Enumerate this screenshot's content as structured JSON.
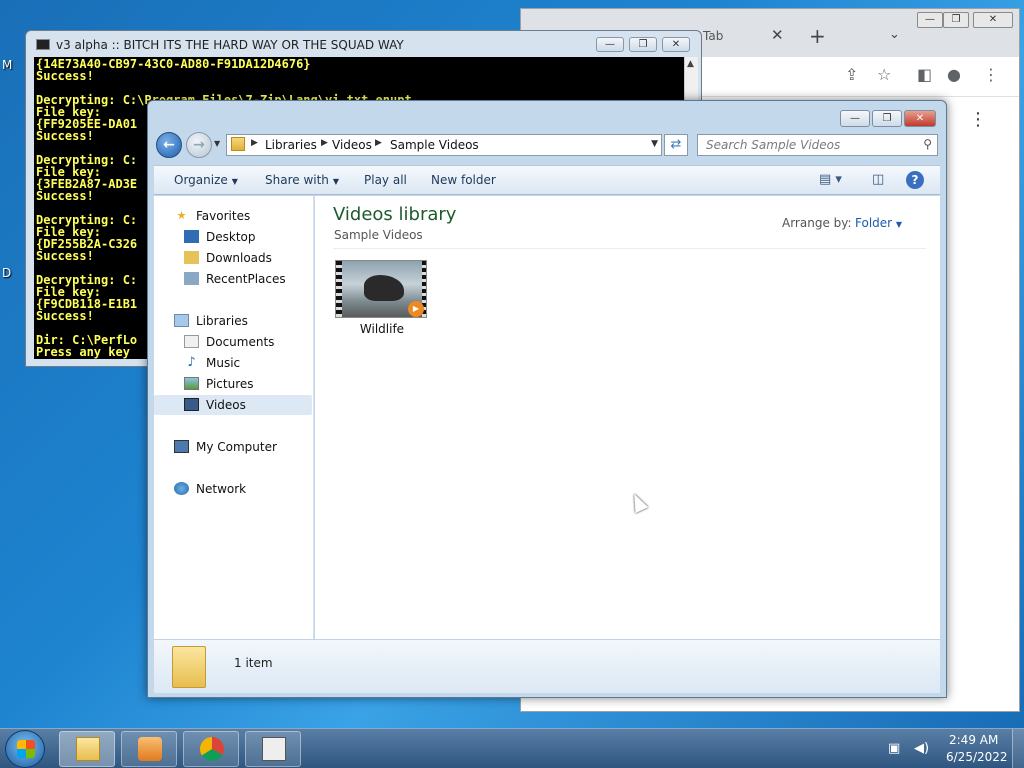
{
  "desktop": {
    "labels": [
      "M",
      "D"
    ]
  },
  "chrome": {
    "tab_label": "Tab",
    "tab_close": "✕",
    "new_tab": "+",
    "dropdown": "⌄",
    "min": "—",
    "max": "❐",
    "close": "✕",
    "toolbar_icons": [
      "share-icon",
      "star-icon",
      "sidebar-icon",
      "profile-icon",
      "menu-icon"
    ],
    "more": "⋮"
  },
  "console": {
    "title": "v3 alpha :: BITCH ITS THE HARD WAY OR THE SQUAD WAY",
    "lines": [
      "{14E73A40-CB97-43C0-AD80-F91DA12D4676}",
      "Success!",
      "",
      "Decrypting: C:\\Program Files\\7-Zip\\Lang\\yi.txt.enupt",
      "File key:",
      "{FF9205EE-DA01",
      "Success!",
      "",
      "Decrypting: C:",
      "File key:",
      "{3FEB2A87-AD3E",
      "Success!",
      "",
      "Decrypting: C:",
      "File key:",
      "{DF255B2A-C326",
      "Success!",
      "",
      "Decrypting: C:",
      "File key:",
      "{F9CDB118-E1B1",
      "Success!",
      "",
      "Dir: C:\\PerfLo",
      "Press any key"
    ],
    "min": "—",
    "max": "❐",
    "close": "✕"
  },
  "explorer": {
    "min": "—",
    "max": "❐",
    "close": "✕",
    "breadcrumb": [
      "Libraries",
      "Videos",
      "Sample Videos"
    ],
    "search_placeholder": "Search Sample Videos",
    "commands": {
      "organize": "Organize",
      "share_with": "Share with",
      "play_all": "Play all",
      "new_folder": "New folder"
    },
    "nav": {
      "favorites": "Favorites",
      "desktop": "Desktop",
      "downloads": "Downloads",
      "recent": "RecentPlaces",
      "libraries": "Libraries",
      "documents": "Documents",
      "music": "Music",
      "pictures": "Pictures",
      "videos": "Videos",
      "my_computer": "My Computer",
      "network": "Network"
    },
    "library_title": "Videos library",
    "library_sub": "Sample Videos",
    "arrange_label": "Arrange by:",
    "arrange_value": "Folder",
    "items": [
      {
        "name": "Wildlife"
      }
    ],
    "item_count": "1 item"
  },
  "taskbar": {
    "time": "2:49 AM",
    "date": "6/25/2022"
  }
}
